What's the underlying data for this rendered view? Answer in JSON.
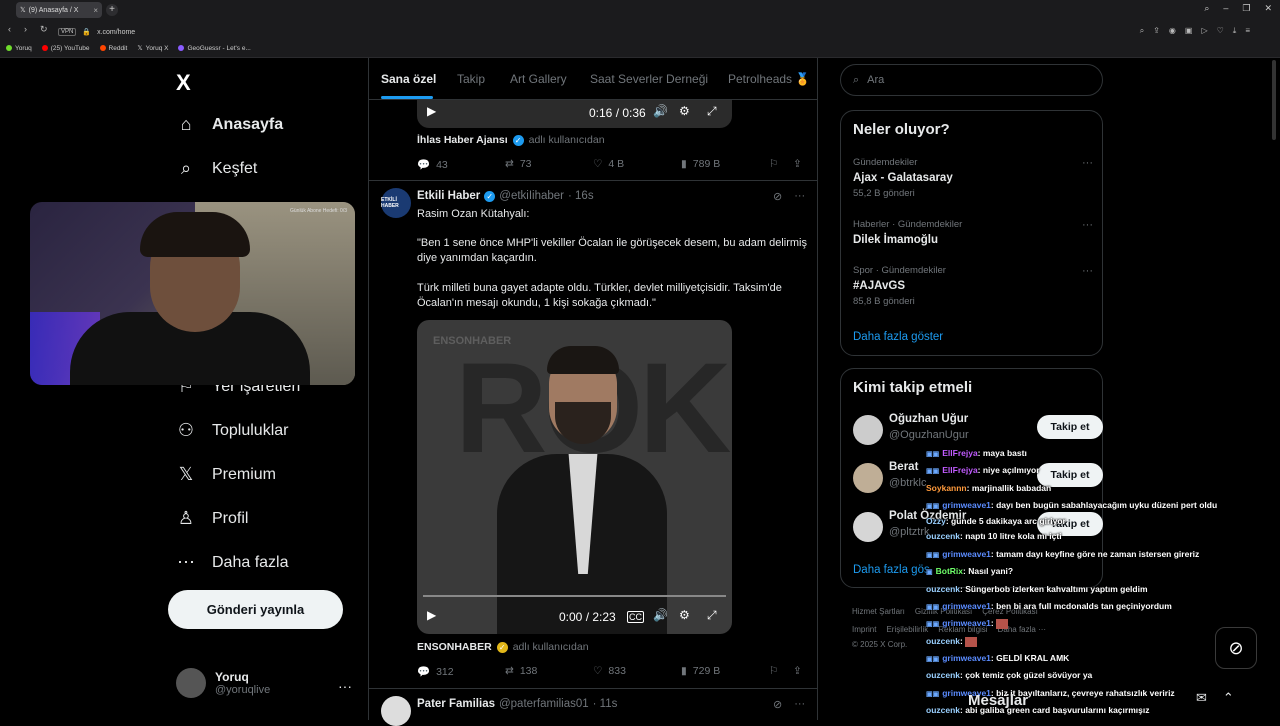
{
  "browser": {
    "tab_title": "(9) Anasayfa / X",
    "url": "x.com/home",
    "vpn": "VPN",
    "bookmarks": [
      "Yoruq",
      "(25) YouTube",
      "Reddit",
      "Yoruq X",
      "GeoGuessr - Let's e..."
    ]
  },
  "sidebar": {
    "logo": "X",
    "nav": [
      {
        "label": "Anasayfa",
        "icon": "home-icon"
      },
      {
        "label": "Keşfet",
        "icon": "search-icon"
      },
      {
        "label": "Yer işaretleri",
        "icon": "bookmark-icon"
      },
      {
        "label": "Topluluklar",
        "icon": "communities-icon"
      },
      {
        "label": "Premium",
        "icon": "x-premium-icon"
      },
      {
        "label": "Profil",
        "icon": "profile-icon"
      },
      {
        "label": "Daha fazla",
        "icon": "more-circle-icon"
      }
    ],
    "post_button": "Gönderi yayınla",
    "account": {
      "name": "Yoruq",
      "handle": "@yoruqlive"
    }
  },
  "webcam": {
    "caption": "Günlük Abone Hedefi: 0/3"
  },
  "main": {
    "tabs": [
      "Sana özel",
      "Takip",
      "Art Gallery",
      "Saat Severler Derneği",
      "Petrolheads 🏅"
    ],
    "prev_tweet": {
      "video_time": "0:16 / 0:36",
      "source_name": "İhlas Haber Ajansı",
      "source_sub": "adlı kullanıcıdan",
      "replies": "43",
      "reposts": "73",
      "likes": "4 B",
      "views": "789 B"
    },
    "tweet": {
      "avatar_text": "ETKİLİ HABER",
      "name": "Etkili Haber",
      "handle": "@etkiIihaber",
      "time": "· 16s",
      "text_1": "Rasim Ozan Kütahyalı:",
      "text_2": "\"Ben 1 sene önce MHP'li vekiller Öcalan ile görüşecek desem, bu adam delirmiş diye yanımdan kaçardın.",
      "text_3": "Türk milleti buna gayet adapte oldu. Türkler, devlet milliyetçisidir. Taksim'de Öcalan'ın mesajı okundu, 1 kişi sokağa çıkmadı.\"",
      "video_brand": "ENSONHABER",
      "video_big": "ROK",
      "video_time": "0:00 / 2:23",
      "source_name": "ENSONHABER",
      "source_sub": "adlı kullanıcıdan",
      "replies": "312",
      "reposts": "138",
      "likes": "833",
      "views": "729 B"
    },
    "next_tweet": {
      "name": "Pater Familias",
      "handle": "@paterfamilias01",
      "time": "· 11s"
    }
  },
  "right": {
    "search_placeholder": "Ara",
    "trends_title": "Neler oluyor?",
    "trends": [
      {
        "meta": "Gündemdekiler",
        "topic": "Ajax - Galatasaray",
        "count": "55,2 B gönderi"
      },
      {
        "meta": "Haberler · Gündemdekiler",
        "topic": "Dilek İmamoğlu",
        "count": ""
      },
      {
        "meta": "Spor · Gündemdekiler",
        "topic": "#AJAvGS",
        "count": "85,8 B gönderi"
      }
    ],
    "show_more": "Daha fazla göster",
    "who_title": "Kimi takip etmeli",
    "who": [
      {
        "name": "Oğuzhan Uğur",
        "handle": "@OguzhanUgur",
        "button": "Takip et"
      },
      {
        "name": "Berat",
        "handle": "@btrklc",
        "button": "Takip et"
      },
      {
        "name": "Polat Özdemir",
        "handle": "@pltztrk",
        "button": "Takip et"
      }
    ],
    "who_more": "Daha fazla gös",
    "footer_1": [
      "Hizmet Şartları",
      "Gizlilik Politikası",
      "Çerez Politikası"
    ],
    "footer_2": [
      "Imprint",
      "Erişilebilirlik",
      "Reklam bilgisi",
      "Daha fazla ···"
    ],
    "copyright": "© 2025 X Corp."
  },
  "chat": [
    {
      "user": "EllFrejya",
      "color": "pink",
      "msg": ": maya bastı"
    },
    {
      "user": "EllFrejya",
      "color": "pink",
      "msg": ": niye açılmıyor"
    },
    {
      "user": "Soykannn",
      "color": "orange",
      "msg": ": marjinallik babadan"
    },
    {
      "user": "grimweave1",
      "color": "blue",
      "msg": ": dayı ben bugün sabahlayacağım uyku düzeni pert oldu"
    },
    {
      "user": "Ozzy",
      "color": "teal",
      "msg": ": günde 5 dakikaya arc giriyor"
    },
    {
      "user": "ouzcenk",
      "color": "teal",
      "msg": ": naptı 10 litre kola mı içti"
    },
    {
      "user": "grimweave1",
      "color": "blue",
      "msg": ": tamam dayı keyfine göre ne zaman istersen gireriz"
    },
    {
      "user": "BotRix",
      "color": "green",
      "msg": ": Nasıl yani?"
    },
    {
      "user": "ouzcenk",
      "color": "teal",
      "msg": ": Süngerbob izlerken kahvaltımı yaptım geldim"
    },
    {
      "user": "grimweave1",
      "color": "blue",
      "msg": ": ben bi ara full mcdonalds tan geçiniyordum"
    },
    {
      "user": "grimweave1",
      "color": "blue",
      "msg": ":"
    },
    {
      "user": "ouzcenk",
      "color": "teal",
      "msg": ":"
    },
    {
      "user": "grimweave1",
      "color": "blue",
      "msg": ": GELDİ KRAL AMK"
    },
    {
      "user": "ouzcenk",
      "color": "teal",
      "msg": ": çok temiz çok güzel sövüyor ya"
    },
    {
      "user": "grimweave1",
      "color": "blue",
      "msg": ": biz it bayıltanlarız, çevreye rahatsızlık veririz"
    },
    {
      "user": "ouzcenk",
      "color": "teal",
      "msg": ": abi galiba green card başvurularını kaçırmışız"
    }
  ],
  "messages": {
    "label": "Mesajlar"
  }
}
